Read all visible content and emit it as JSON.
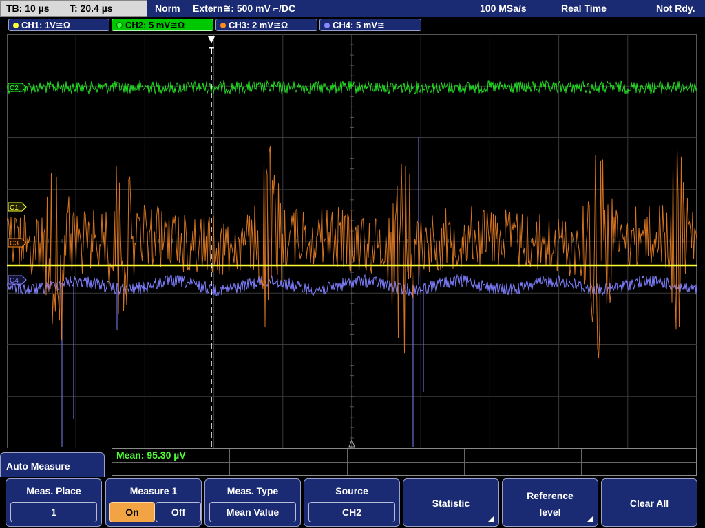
{
  "topbar": {
    "timebase": "TB: 10 µs",
    "trigger_time": "T: 20.4 µs",
    "acq_mode": "Norm",
    "trigger_source": "Extern≅: 500 mV ⌐/DC",
    "sample_rate": "100 MSa/s",
    "mode": "Real Time",
    "status": "Not Rdy."
  },
  "channels": [
    {
      "label": "CH1: 1V≅Ω",
      "color": "#ffff33"
    },
    {
      "label": "CH2: 5 mV≅Ω",
      "color": "#33ff33"
    },
    {
      "label": "CH3: 2 mV≅Ω",
      "color": "#ff8c1a"
    },
    {
      "label": "CH4: 5 mV≅",
      "color": "#8888ff"
    }
  ],
  "markers": {
    "ch2": "C2",
    "ch1": "C1",
    "ch3": "C3",
    "ch4": "C4",
    "trigger": "T"
  },
  "measurement": {
    "readout": "Mean: 95.30 µV"
  },
  "auto_measure": {
    "title": "Auto Measure"
  },
  "softkeys": {
    "meas_place": {
      "title": "Meas. Place",
      "value": "1"
    },
    "measure1": {
      "title": "Measure 1",
      "on": "On",
      "off": "Off"
    },
    "meas_type": {
      "title": "Meas. Type",
      "value": "Mean Value"
    },
    "source": {
      "title": "Source",
      "value": "CH2"
    },
    "statistic": {
      "label": "Statistic"
    },
    "reference": {
      "line1": "Reference",
      "line2": "level"
    },
    "clear_all": {
      "label": "Clear All"
    }
  },
  "colors": {
    "panel_blue": "#1a2a73",
    "ch1_yellow": "#ffff33",
    "ch2_green": "#33ff33",
    "ch3_orange": "#ff8c1a",
    "ch4_blue": "#8888ff",
    "active_orange": "#f2a344"
  }
}
